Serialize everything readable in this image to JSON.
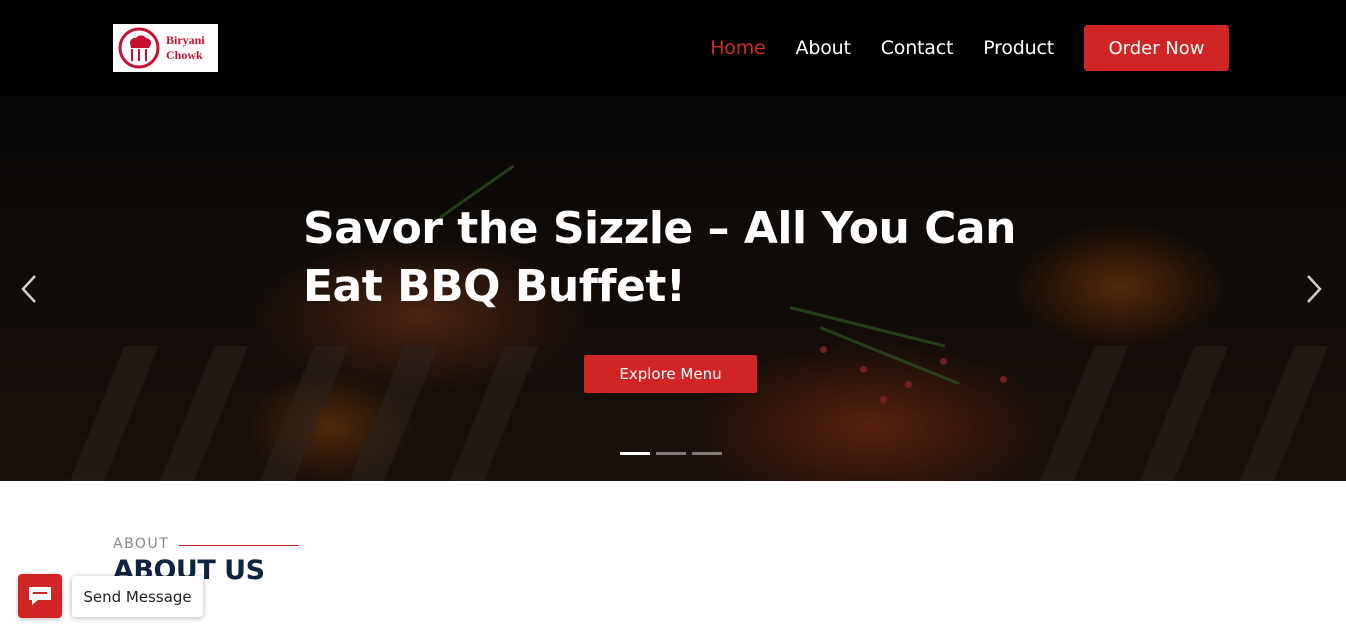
{
  "colors": {
    "accent": "#d12424",
    "header_bg": "#000000",
    "heading_navy": "#0f2340"
  },
  "brand": {
    "line1": "Biryani",
    "line2": "Chowk",
    "icon": "chef-hat-utensils-icon"
  },
  "nav": {
    "items": [
      {
        "label": "Home",
        "active": true
      },
      {
        "label": "About",
        "active": false
      },
      {
        "label": "Contact",
        "active": false
      },
      {
        "label": "Product",
        "active": false
      }
    ],
    "cta_label": "Order Now"
  },
  "hero": {
    "title": "Savor the Sizzle – All You Can Eat BBQ Buffet!",
    "button_label": "Explore Menu",
    "prev_icon": "chevron-left-icon",
    "next_icon": "chevron-right-icon",
    "slides": 3,
    "active_slide": 1
  },
  "about": {
    "kicker": "ABOUT",
    "title": "ABOUT US"
  },
  "chat": {
    "icon": "chat-bubble-icon",
    "label": "Send Message"
  }
}
